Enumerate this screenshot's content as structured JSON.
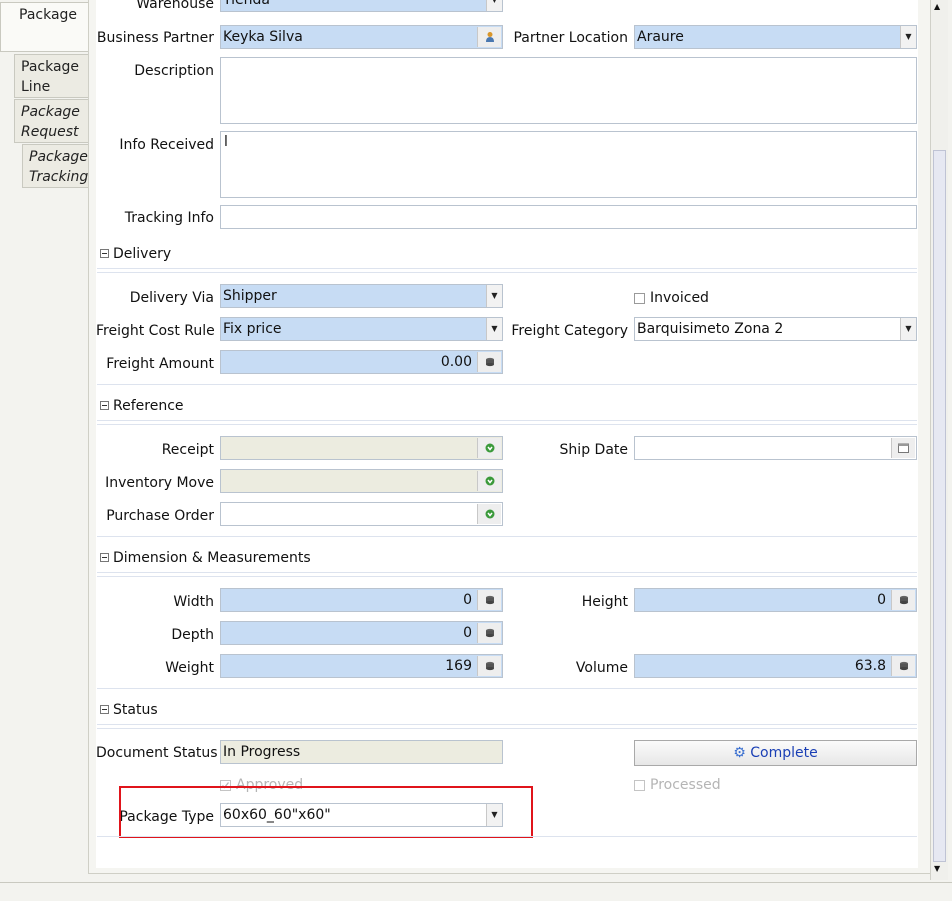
{
  "tabs": [
    {
      "label": "Package",
      "style": "normal"
    },
    {
      "label": "Package Line",
      "style": "normal"
    },
    {
      "label": "Package Request",
      "style": "italic"
    },
    {
      "label": "Package Tracking",
      "style": "italic"
    }
  ],
  "header": {
    "warehouse_label": "Warehouse",
    "warehouse_value": "Tienda",
    "bp_label": "Business Partner",
    "bp_value": "Keyka Silva",
    "partner_location_label": "Partner Location",
    "partner_location_value": "Araure",
    "description_label": "Description",
    "description_value": "",
    "info_received_label": "Info Received",
    "info_received_value": "l",
    "tracking_info_label": "Tracking Info",
    "tracking_info_value": ""
  },
  "delivery": {
    "section_title": "Delivery",
    "delivery_via_label": "Delivery Via",
    "delivery_via_value": "Shipper",
    "invoiced_label": "Invoiced",
    "freight_cost_rule_label": "Freight Cost Rule",
    "freight_cost_rule_value": "Fix price",
    "freight_category_label": "Freight Category",
    "freight_category_value": "Barquisimeto Zona 2",
    "freight_amount_label": "Freight Amount",
    "freight_amount_value": "0.00"
  },
  "reference": {
    "section_title": "Reference",
    "receipt_label": "Receipt",
    "receipt_value": "",
    "ship_date_label": "Ship Date",
    "ship_date_value": "",
    "inventory_move_label": "Inventory Move",
    "inventory_move_value": "",
    "purchase_order_label": "Purchase Order",
    "purchase_order_value": ""
  },
  "dimensions": {
    "section_title": "Dimension & Measurements",
    "width_label": "Width",
    "width_value": "0",
    "height_label": "Height",
    "height_value": "0",
    "depth_label": "Depth",
    "depth_value": "0",
    "weight_label": "Weight",
    "weight_value": "169",
    "volume_label": "Volume",
    "volume_value": "63.8"
  },
  "status": {
    "section_title": "Status",
    "document_status_label": "Document Status",
    "document_status_value": "In Progress",
    "complete_button": "Complete",
    "approved_label": "Approved",
    "processed_label": "Processed",
    "package_type_label": "Package Type",
    "package_type_value": "60x60_60\"x60\""
  },
  "colors": {
    "mandatory_field": "#c7dcf4",
    "readonly_field": "#ecece0",
    "highlight": "#e0141b",
    "complete_text": "#1a3fb5"
  }
}
